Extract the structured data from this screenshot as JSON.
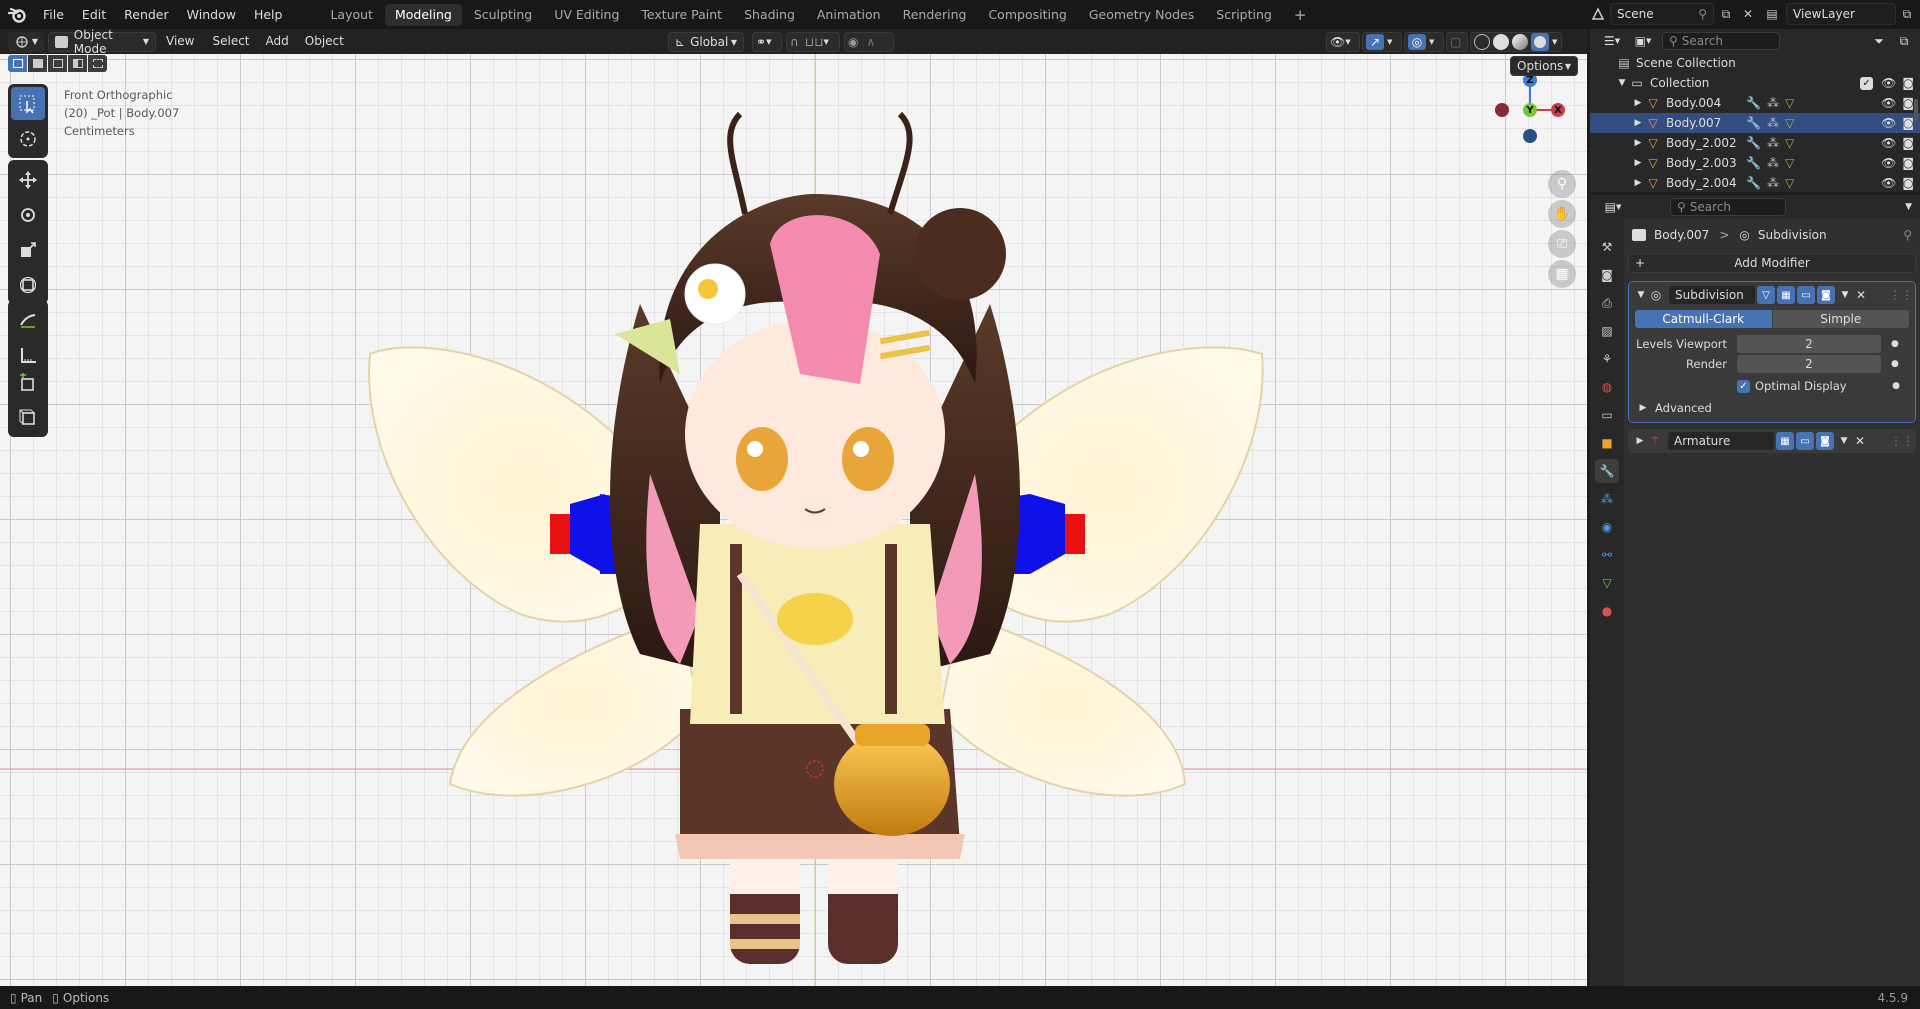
{
  "app": {
    "version": "4.5.9"
  },
  "menu": [
    "File",
    "Edit",
    "Render",
    "Window",
    "Help"
  ],
  "workspaces": [
    {
      "label": "Layout",
      "active": false
    },
    {
      "label": "Modeling",
      "active": true
    },
    {
      "label": "Sculpting",
      "active": false
    },
    {
      "label": "UV Editing",
      "active": false
    },
    {
      "label": "Texture Paint",
      "active": false
    },
    {
      "label": "Shading",
      "active": false
    },
    {
      "label": "Animation",
      "active": false
    },
    {
      "label": "Rendering",
      "active": false
    },
    {
      "label": "Compositing",
      "active": false
    },
    {
      "label": "Geometry Nodes",
      "active": false
    },
    {
      "label": "Scripting",
      "active": false
    }
  ],
  "add_workspace_label": "+",
  "scene": {
    "name": "Scene"
  },
  "view_layer": {
    "name": "ViewLayer"
  },
  "viewport": {
    "mode_label": "Object Mode",
    "menu": [
      "View",
      "Select",
      "Add",
      "Object"
    ],
    "transform_orientation": "Global",
    "options_label": "Options",
    "overlay_text": [
      "Front Orthographic",
      "(20) _Pot | Body.007",
      "Centimeters"
    ],
    "gizmo": {
      "z": "Z",
      "y": "Y",
      "x": "X"
    }
  },
  "outliner": {
    "search_placeholder": "Search",
    "root": "Scene Collection",
    "collection": "Collection",
    "items": [
      "Body.004",
      "Body.007",
      "Body_2.002",
      "Body_2.003",
      "Body_2.004"
    ]
  },
  "properties": {
    "search_placeholder": "Search",
    "breadcrumb_object": "Body.007",
    "breadcrumb_separator": ">",
    "breadcrumb_modifier": "Subdivision",
    "add_modifier_label": "Add Modifier",
    "add_modifier_plus": "+",
    "modifiers": [
      {
        "name": "Subdivision",
        "expanded": true,
        "algorithms": [
          "Catmull-Clark",
          "Simple"
        ],
        "active_algorithm": "Catmull-Clark",
        "levels_viewport_label": "Levels Viewport",
        "levels_viewport": "2",
        "render_label": "Render",
        "render": "2",
        "optimal_display_label": "Optimal Display",
        "optimal_display": true,
        "advanced_label": "Advanced"
      },
      {
        "name": "Armature",
        "expanded": false
      }
    ]
  },
  "status": {
    "pan": "Pan",
    "options": "Options"
  },
  "colors": {
    "accent": "#4772b3",
    "active_tab": "#4772b3",
    "x_axis": "#cb3d4b",
    "y_axis": "#7cc533",
    "z_axis": "#3a7bd5"
  }
}
